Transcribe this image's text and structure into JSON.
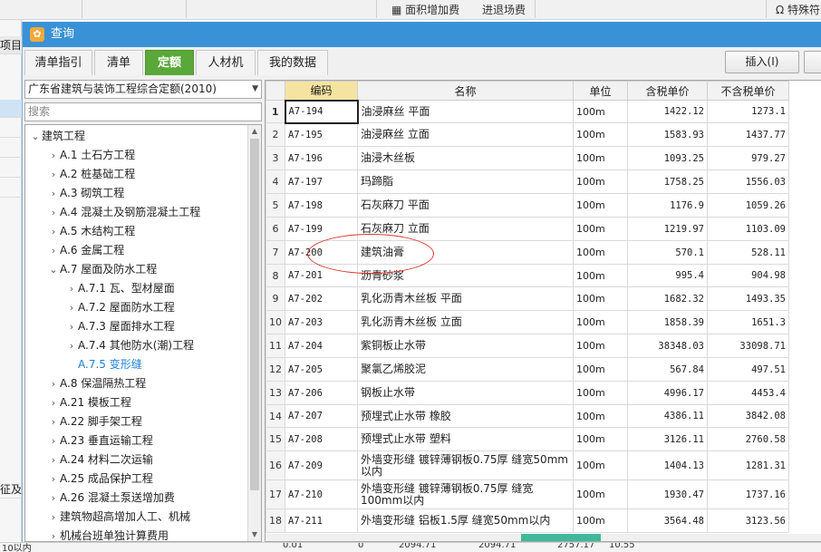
{
  "bg_toolbar": {
    "items": [
      "面积增加费",
      "进退场费",
      "特殊符"
    ]
  },
  "bg_left": {
    "rows": [
      "项目",
      "征及"
    ]
  },
  "bg_bottom": {
    "values": [
      "10以内",
      "0.01",
      "0",
      "2094.71",
      "2094.71",
      "2757.17",
      "10.55"
    ]
  },
  "dialog": {
    "title": "查询",
    "title_icon": "brand-icon",
    "tabs": [
      {
        "label": "清单指引"
      },
      {
        "label": "清单"
      },
      {
        "label": "定额"
      },
      {
        "label": "人材机"
      },
      {
        "label": "我的数据"
      }
    ],
    "insert_button": "插入(I)",
    "accent_color": "#5aa83a",
    "title_color": "#3a92d6"
  },
  "left": {
    "quota_library": "广东省建筑与装饰工程综合定额(2010)",
    "search_placeholder": "搜索",
    "tree": [
      {
        "label": "建筑工程",
        "level": 0,
        "state": "expanded"
      },
      {
        "label": "A.1 土石方工程",
        "level": 1,
        "state": "collapsed"
      },
      {
        "label": "A.2 桩基础工程",
        "level": 1,
        "state": "collapsed"
      },
      {
        "label": "A.3 砌筑工程",
        "level": 1,
        "state": "collapsed"
      },
      {
        "label": "A.4 混凝土及钢筋混凝土工程",
        "level": 1,
        "state": "collapsed"
      },
      {
        "label": "A.5 木结构工程",
        "level": 1,
        "state": "collapsed"
      },
      {
        "label": "A.6 金属工程",
        "level": 1,
        "state": "collapsed"
      },
      {
        "label": "A.7 屋面及防水工程",
        "level": 1,
        "state": "expanded"
      },
      {
        "label": "A.7.1 瓦、型材屋面",
        "level": 2,
        "state": "collapsed"
      },
      {
        "label": "A.7.2 屋面防水工程",
        "level": 2,
        "state": "collapsed"
      },
      {
        "label": "A.7.3 屋面排水工程",
        "level": 2,
        "state": "collapsed"
      },
      {
        "label": "A.7.4 其他防水(潮)工程",
        "level": 2,
        "state": "collapsed"
      },
      {
        "label": "A.7.5 变形缝",
        "level": 2,
        "state": "leaf",
        "selected": true
      },
      {
        "label": "A.8 保温隔热工程",
        "level": 1,
        "state": "collapsed"
      },
      {
        "label": "A.21 模板工程",
        "level": 1,
        "state": "collapsed"
      },
      {
        "label": "A.22 脚手架工程",
        "level": 1,
        "state": "collapsed"
      },
      {
        "label": "A.23 垂直运输工程",
        "level": 1,
        "state": "collapsed"
      },
      {
        "label": "A.24 材料二次运输",
        "level": 1,
        "state": "collapsed"
      },
      {
        "label": "A.25 成品保护工程",
        "level": 1,
        "state": "collapsed"
      },
      {
        "label": "A.26 混凝土泵送增加费",
        "level": 1,
        "state": "collapsed"
      },
      {
        "label": "建筑物超高增加人工、机械",
        "level": 1,
        "state": "collapsed"
      },
      {
        "label": "机械台班单独计算费用",
        "level": 1,
        "state": "collapsed"
      }
    ]
  },
  "grid": {
    "columns": [
      "",
      "编码",
      "名称",
      "单位",
      "含税单价",
      "不含税单价"
    ],
    "selected_index": 0,
    "rows": [
      {
        "no": "1",
        "code": "A7-194",
        "name": "油浸麻丝 平面",
        "unit": "100m",
        "tax_price": "1422.12",
        "net_price": "1273.1"
      },
      {
        "no": "2",
        "code": "A7-195",
        "name": "油浸麻丝 立面",
        "unit": "100m",
        "tax_price": "1583.93",
        "net_price": "1437.77"
      },
      {
        "no": "3",
        "code": "A7-196",
        "name": "油浸木丝板",
        "unit": "100m",
        "tax_price": "1093.25",
        "net_price": "979.27"
      },
      {
        "no": "4",
        "code": "A7-197",
        "name": "玛蹄脂",
        "unit": "100m",
        "tax_price": "1758.25",
        "net_price": "1556.03"
      },
      {
        "no": "5",
        "code": "A7-198",
        "name": "石灰麻刀 平面",
        "unit": "100m",
        "tax_price": "1176.9",
        "net_price": "1059.26"
      },
      {
        "no": "6",
        "code": "A7-199",
        "name": "石灰麻刀 立面",
        "unit": "100m",
        "tax_price": "1219.97",
        "net_price": "1103.09"
      },
      {
        "no": "7",
        "code": "A7-200",
        "name": "建筑油膏",
        "unit": "100m",
        "tax_price": "570.1",
        "net_price": "528.11"
      },
      {
        "no": "8",
        "code": "A7-201",
        "name": "沥青砂浆",
        "unit": "100m",
        "tax_price": "995.4",
        "net_price": "904.98"
      },
      {
        "no": "9",
        "code": "A7-202",
        "name": "乳化沥青木丝板 平面",
        "unit": "100m",
        "tax_price": "1682.32",
        "net_price": "1493.35"
      },
      {
        "no": "10",
        "code": "A7-203",
        "name": "乳化沥青木丝板 立面",
        "unit": "100m",
        "tax_price": "1858.39",
        "net_price": "1651.3"
      },
      {
        "no": "11",
        "code": "A7-204",
        "name": "紫铜板止水带",
        "unit": "100m",
        "tax_price": "38348.03",
        "net_price": "33098.71"
      },
      {
        "no": "12",
        "code": "A7-205",
        "name": "聚氯乙烯胶泥",
        "unit": "100m",
        "tax_price": "567.84",
        "net_price": "497.51"
      },
      {
        "no": "13",
        "code": "A7-206",
        "name": "钢板止水带",
        "unit": "100m",
        "tax_price": "4996.17",
        "net_price": "4453.4"
      },
      {
        "no": "14",
        "code": "A7-207",
        "name": "预埋式止水带 橡胶",
        "unit": "100m",
        "tax_price": "4386.11",
        "net_price": "3842.08"
      },
      {
        "no": "15",
        "code": "A7-208",
        "name": "预埋式止水带 塑料",
        "unit": "100m",
        "tax_price": "3126.11",
        "net_price": "2760.58"
      },
      {
        "no": "16",
        "code": "A7-209",
        "name": "外墙变形缝 镀锌薄钢板0.75厚 缝宽50mm以内",
        "unit": "100m",
        "tax_price": "1404.13",
        "net_price": "1281.31"
      },
      {
        "no": "17",
        "code": "A7-210",
        "name": "外墙变形缝 镀锌薄钢板0.75厚 缝宽100mm以内",
        "unit": "100m",
        "tax_price": "1930.47",
        "net_price": "1737.16"
      },
      {
        "no": "18",
        "code": "A7-211",
        "name": "外墙变形缝 铝板1.5厚 缝宽50mm以内",
        "unit": "100m",
        "tax_price": "3564.48",
        "net_price": "3123.56"
      }
    ]
  }
}
